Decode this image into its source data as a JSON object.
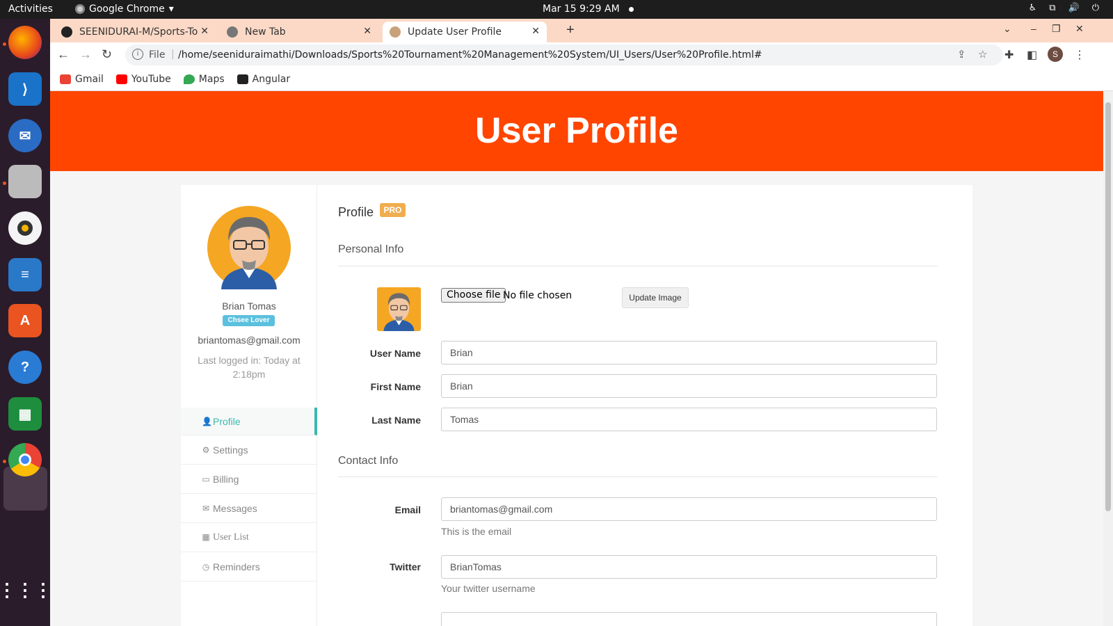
{
  "os": {
    "activities": "Activities",
    "app_name": "Google Chrome",
    "clock": "Mar 15  9:29 AM"
  },
  "browser": {
    "tabs": [
      {
        "label": "SEENIDURAI-M/Sports-To",
        "icon": "github-icon"
      },
      {
        "label": "New Tab",
        "icon": "chrome-icon"
      },
      {
        "label": "Update User Profile",
        "icon": "user-icon",
        "active": true
      }
    ],
    "url_scheme": "File",
    "url": "/home/seeniduraimathi/Downloads/Sports%20Tournament%20Management%20System/UI_Users/User%20Profile.html#",
    "profile_initial": "S",
    "bookmarks": [
      {
        "label": "Gmail",
        "color": "#ea4335"
      },
      {
        "label": "YouTube",
        "color": "#ff0000"
      },
      {
        "label": "Maps",
        "color": "#34a853"
      },
      {
        "label": "Angular",
        "color": "#222222"
      }
    ]
  },
  "page": {
    "header_title": "User Profile",
    "header_color": "#ff4500",
    "user": {
      "name": "Brian Tomas",
      "badge": "Chsee Lover",
      "email": "briantomas@gmail.com",
      "last_login": "Last logged in: Today at 2:18pm"
    },
    "menu": [
      {
        "label": "Profile",
        "icon": "user-icon",
        "active": true
      },
      {
        "label": "Settings",
        "icon": "gear-icon"
      },
      {
        "label": "Billing",
        "icon": "credit-card-icon"
      },
      {
        "label": "Messages",
        "icon": "envelope-icon"
      },
      {
        "label": "User List",
        "icon": "grid-icon"
      },
      {
        "label": "Reminders",
        "icon": "clock-icon"
      }
    ],
    "profile_title": "Profile",
    "pro_badge": "PRO",
    "personal_info": "Personal Info",
    "file_button": "Choose file",
    "file_status": "No file chosen",
    "update_image": "Update Image",
    "fields": {
      "username_label": "User Name",
      "username": "Brian",
      "firstname_label": "First Name",
      "firstname": "Brian",
      "lastname_label": "Last Name",
      "lastname": "Tomas"
    },
    "contact_info": "Contact Info",
    "contact": {
      "email_label": "Email",
      "email": "briantomas@gmail.com",
      "email_help": "This is the email",
      "twitter_label": "Twitter",
      "twitter": "BrianTomas",
      "twitter_help": "Your twitter username"
    }
  }
}
